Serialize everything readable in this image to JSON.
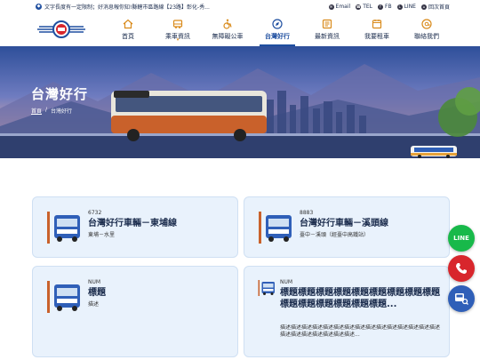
{
  "marquee": {
    "text": "文字長度有一定限制；好消息報你知!縣轄市區路線【23路】彰化-秀..."
  },
  "toplinks": [
    {
      "label": "Email",
      "icon": "email-icon"
    },
    {
      "label": "TEL",
      "icon": "phone-icon"
    },
    {
      "label": "FB",
      "icon": "facebook-icon"
    },
    {
      "label": "LINE",
      "icon": "line-icon"
    },
    {
      "label": "回次首頁",
      "icon": "home-icon"
    }
  ],
  "nav": {
    "items": [
      {
        "label": "首頁",
        "icon": "home-icon"
      },
      {
        "label": "乘車資訊",
        "icon": "bus-info-icon"
      },
      {
        "label": "無障礙公車",
        "icon": "wheelchair-icon"
      },
      {
        "label": "台灣好行",
        "icon": "compass-icon"
      },
      {
        "label": "最新資訊",
        "icon": "news-icon"
      },
      {
        "label": "我要租車",
        "icon": "rent-icon"
      },
      {
        "label": "聯絡我們",
        "icon": "contact-icon"
      }
    ],
    "active_index": 3
  },
  "hero": {
    "title": "台灣好行",
    "breadcrumb": {
      "home": "首頁",
      "sep": "/",
      "current": "台灣好行"
    }
  },
  "cards": [
    {
      "num": "6732",
      "title": "台灣好行車輛－東埔線",
      "sub": "東埔－水里"
    },
    {
      "num": "8883",
      "title": "台灣好行車輛－溪頭線",
      "sub": "臺中－溪頭（經臺中高鐵站）"
    },
    {
      "num": "NUM",
      "title": "標題",
      "sub": "描述"
    },
    {
      "num": "NUM",
      "title": "標題標題標題標題標題標題標題標題標題標題標題標題標題標題標題...",
      "sub": "描述描述描述描述描述描述描述描述描述描述描述描述描述描述描述描述描述描述描述描述描述描述..."
    }
  ],
  "fabs": [
    {
      "label": "LINE",
      "color": "#18b94a",
      "icon": "line-icon"
    },
    {
      "label": "TEL",
      "color": "#d8262c",
      "icon": "phone-icon"
    },
    {
      "label": "BUS",
      "color": "#2f5fb8",
      "icon": "bus-search-icon"
    }
  ],
  "colors": {
    "accent": "#1f4fa0",
    "card_bg": "#e9f2fc",
    "orange": "#d98a1a"
  }
}
